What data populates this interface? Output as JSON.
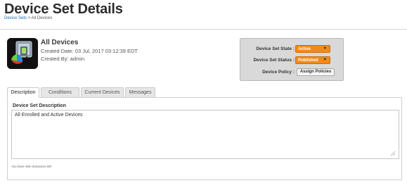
{
  "header": {
    "title": "Device Set Details",
    "breadcrumb": {
      "link": "Device Sets",
      "separator": ">",
      "current": "All Devices"
    }
  },
  "device": {
    "icon": "device-set-icon",
    "name": "All Devices",
    "created_date": "Created Date: 03 Jul, 2017 03:12:39 EDT",
    "created_by": "Created By: admin"
  },
  "status_panel": {
    "state_label": "Device Set State :",
    "state_value": "Active",
    "status_label": "Device Set Status :",
    "status_value": "Published",
    "policy_label": "Device Policy :",
    "policy_button": "Assign Policies",
    "accent_color": "#f28a1a"
  },
  "tabs": [
    {
      "label": "Description",
      "active": true
    },
    {
      "label": "Conditions",
      "active": false
    },
    {
      "label": "Current Devices",
      "active": false
    },
    {
      "label": "Messages",
      "active": false
    }
  ],
  "description": {
    "section_label": "Device Set Description",
    "text": "All Enrolled and Active Devices",
    "char_count": "You have 469 characters left"
  }
}
